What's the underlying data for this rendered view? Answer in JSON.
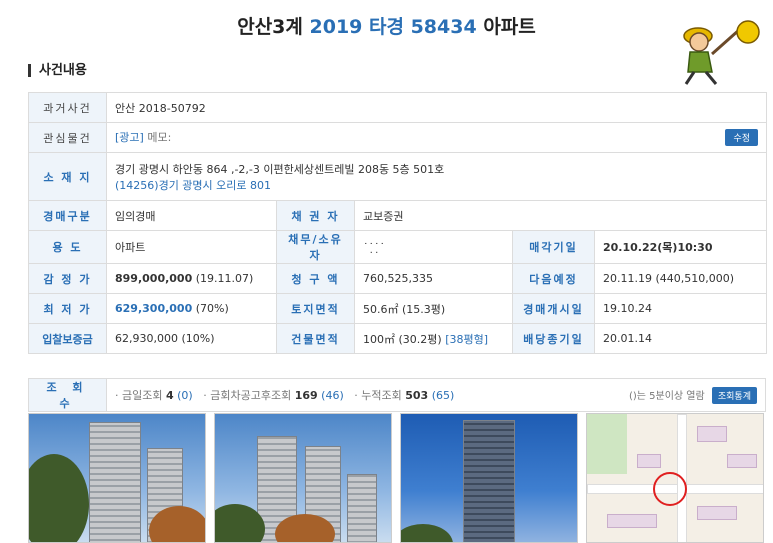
{
  "header": {
    "region": "안산3계",
    "case_number": "2019 타경 58434",
    "type": "아파트"
  },
  "section": {
    "title": "사건내용"
  },
  "table": {
    "past_case_label": "과거사건",
    "past_case_value": "안산 2018-50792",
    "interest_label": "관심물건",
    "interest_ad": "[광고]",
    "interest_memo": "메모:",
    "edit_button": "수정",
    "location_label": "소 재 지",
    "address_line1": "경기 광명시 하안동 864 ,-2,-3 이편한세상센트레빌 208동 5층 501호",
    "address_line2": "(14256)경기 광명시 오리로 801",
    "auction_type_label": "경매구분",
    "auction_type_value": "임의경매",
    "creditor_label": "채 권 자",
    "creditor_value": "교보증권",
    "usage_label": "용 도",
    "usage_value": "아파트",
    "debtor_label": "채무/소유자",
    "debtor_value": "˙˙̣˙̣˙",
    "sale_date_label": "매각기일",
    "sale_date_value": "20.10.22(목)10:30",
    "appraisal_label": "감 정 가",
    "appraisal_value": "899,000,000",
    "appraisal_date": "(19.11.07)",
    "claim_label": "청 구 액",
    "claim_value": "760,525,335",
    "next_label": "다음예정",
    "next_value": "20.11.19 (440,510,000)",
    "min_label": "최 저 가",
    "min_value": "629,300,000",
    "min_pct": "(70%)",
    "land_label": "토지면적",
    "land_value": "50.6㎡ (15.3평)",
    "start_label": "경매개시일",
    "start_value": "19.10.24",
    "deposit_label": "입찰보증금",
    "deposit_value": "62,930,000 (10%)",
    "building_label": "건물면적",
    "building_value": "100㎡ (30.2평)",
    "building_type": "[38평형]",
    "dividend_label": "배당종기일",
    "dividend_value": "20.01.14"
  },
  "views": {
    "label": "조 회 수",
    "today_label": "· 금일조회",
    "today_count": "4",
    "today_sub": "(0)",
    "after_label": "· 금회차공고후조회",
    "after_count": "169",
    "after_sub": "(46)",
    "total_label": "· 누적조회",
    "total_count": "503",
    "total_sub": "(65)",
    "note": "()는 5분이상 열람",
    "stats_button": "조회통계"
  },
  "colors": {
    "accent": "#2a6fb5",
    "label_bg": "#eef4fa",
    "border": "#dcdcdc"
  }
}
